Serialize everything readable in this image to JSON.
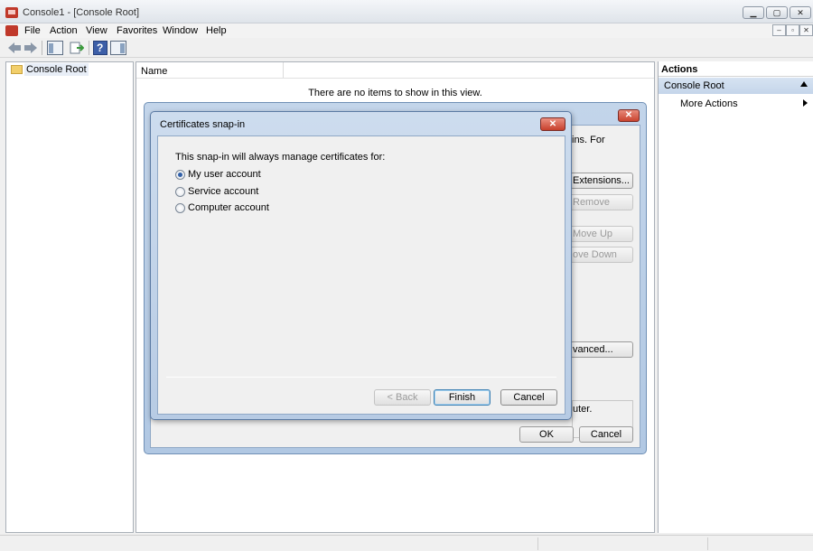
{
  "window": {
    "title": "Console1 - [Console Root]",
    "caption_min": "▁",
    "caption_max": "▢",
    "caption_close": "✕"
  },
  "menu": [
    "File",
    "Action",
    "View",
    "Favorites",
    "Window",
    "Help"
  ],
  "mdi_controls": [
    "–",
    "▫",
    "✕"
  ],
  "toolbar": {
    "back_icon": "arrow-left-icon",
    "forward_icon": "arrow-right-icon",
    "show_tree_icon": "console-tree-icon",
    "export_icon": "export-list-icon",
    "help_icon": "help-icon",
    "action_pane_icon": "action-pane-icon",
    "help_glyph": "?"
  },
  "tree": {
    "root_label": "Console Root"
  },
  "list": {
    "column_name": "Name",
    "empty_message": "There are no items to show in this view."
  },
  "actions": {
    "header": "Actions",
    "section_label": "Console Root",
    "more_actions": "More Actions"
  },
  "background_dialog": {
    "close_glyph": "✕",
    "text_fragment_1": "ins. For",
    "btn_extensions": "Extensions...",
    "btn_remove": "Remove",
    "btn_move_up": "Move Up",
    "btn_move_down": "ove Down",
    "btn_advanced": "vanced...",
    "desc_fragment": "uter.",
    "btn_ok": "OK",
    "btn_cancel": "Cancel"
  },
  "cert_dialog": {
    "title": "Certificates snap-in",
    "close_glyph": "✕",
    "prompt": "This snap-in will always manage certificates for:",
    "options": [
      {
        "label": "My user account",
        "checked": true
      },
      {
        "label": "Service account",
        "checked": false
      },
      {
        "label": "Computer account",
        "checked": false
      }
    ],
    "btn_back": "< Back",
    "btn_finish": "Finish",
    "btn_cancel": "Cancel"
  },
  "colors": {
    "accent_blue": "#3160a8",
    "close_red": "#c7402c",
    "selection_blue": "#c5d5ea"
  }
}
